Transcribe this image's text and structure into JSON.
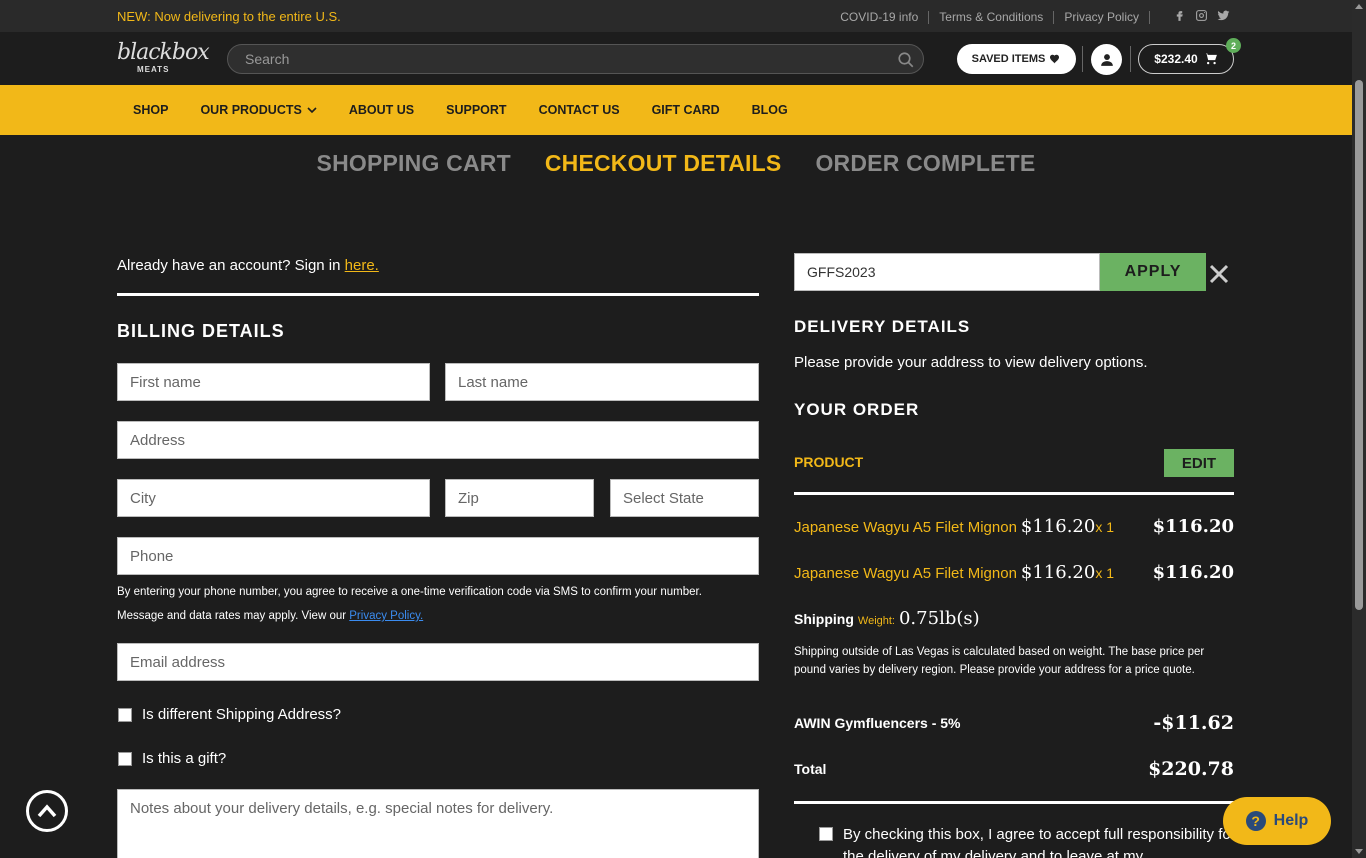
{
  "topbar": {
    "promo": "NEW: Now delivering to the entire U.S.",
    "links": [
      "COVID-19 info",
      "Terms & Conditions",
      "Privacy Policy"
    ],
    "social_icons": [
      "facebook-icon",
      "instagram-icon",
      "twitter-icon"
    ]
  },
  "header": {
    "logo_script": "blackbox",
    "logo_sub": "MEATS",
    "search_placeholder": "Search",
    "saved_items_label": "SAVED ITEMS",
    "cart_total": "$232.40",
    "cart_count": "2"
  },
  "nav": {
    "items": [
      "SHOP",
      "OUR PRODUCTS",
      "ABOUT US",
      "SUPPORT",
      "CONTACT US",
      "GIFT CARD",
      "BLOG"
    ]
  },
  "steps": {
    "cart": "SHOPPING CART",
    "checkout": "CHECKOUT DETAILS",
    "complete": "ORDER COMPLETE"
  },
  "billing": {
    "signin_text": "Already have an account? Sign in ",
    "signin_link": "here.",
    "title": "BILLING DETAILS",
    "first_name_placeholder": "First name",
    "last_name_placeholder": "Last name",
    "address_placeholder": "Address",
    "city_placeholder": "City",
    "zip_placeholder": "Zip",
    "state_placeholder": "Select State",
    "phone_placeholder": "Phone",
    "phone_note_1": "By entering your phone number, you agree to receive a one-time verification code via SMS to confirm your number.",
    "phone_note_2": "Message and data rates may apply. View our ",
    "privacy_link": "Privacy Policy.",
    "email_placeholder": "Email address",
    "diff_shipping_label": "Is different Shipping Address?",
    "gift_label": "Is this a gift?",
    "notes_placeholder": "Notes about your delivery details, e.g. special notes for delivery."
  },
  "order": {
    "coupon_value": "GFFS2023",
    "apply_label": "APPLY",
    "delivery_title": "DELIVERY DETAILS",
    "delivery_text": "Please provide your address to view delivery options.",
    "your_order_title": "YOUR ORDER",
    "product_header": "PRODUCT",
    "edit_label": "EDIT",
    "items": [
      {
        "name": "Japanese Wagyu A5 Filet Mignon",
        "price": "$116.20",
        "qty": "x 1",
        "total": "$116.20"
      },
      {
        "name": "Japanese Wagyu A5 Filet Mignon",
        "price": "$116.20",
        "qty": "x 1",
        "total": "$116.20"
      }
    ],
    "shipping_label": "Shipping",
    "weight_label": "Weight:",
    "weight_value": "0.75lb(s)",
    "shipping_note": "Shipping outside of Las Vegas is calculated based on weight. The base price per pound varies by delivery region. Please provide your address for a price quote.",
    "discount_label": "AWIN Gymfluencers - 5%",
    "discount_value": "-$11.62",
    "total_label": "Total",
    "total_value": "$220.78",
    "agree_text": "By checking this box, I agree to accept full responsibility for the delivery of my delivery and to leave at my"
  },
  "help_label": "Help",
  "colors": {
    "accent": "#f2b818",
    "green": "#6bb262",
    "bg": "#1d1d1d",
    "link": "#3b8cf0"
  }
}
